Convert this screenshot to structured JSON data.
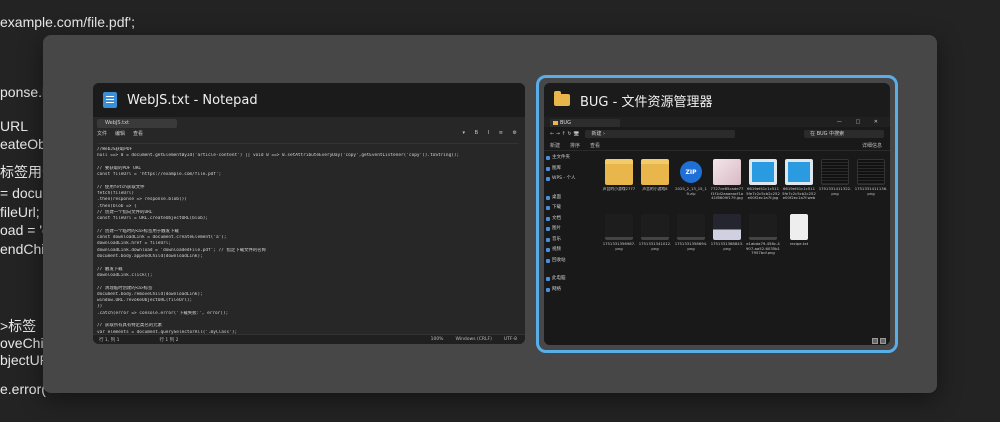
{
  "background_code": [
    "example.com/file.pdf';",
    "ponse.b",
    "URL",
    "eateObj",
    "标签用于",
    "= docum",
    "fileUrl;",
    "oad = 'c",
    "endChild",
    ">标签",
    "oveChilc",
    "bjectUR",
    "e.error("
  ],
  "switcher": {
    "notepad": {
      "title": "WebJS.txt - Notepad",
      "tab_label": "WebJS.txt",
      "menu": [
        "文件",
        "编辑",
        "查看"
      ],
      "tools": "▾ B I ≡ ⚙",
      "lines": [
        "//WebJS获取PDF",
        "null ==> 0 = document.getElementById('article-content') || void 0 ==> 0.setAttributeEveryDay('copy',getEventListener('copy')).toString();",
        "",
        "// 要获取的PDF URL",
        "const fileUrl = 'https://example.com/file.pdf';",
        "",
        "// 使用fetch获取文件",
        "fetch(fileUrl)",
        "  .then(response => response.blob())",
        "  .then(blob => {",
        "    // 创建一个指向文件的URL",
        "    const fileUrl = URL.createObjectURL(blob);",
        "",
        "    // 创建一个临时的<a>标签用于触发下载",
        "    const downloadLink = document.createElement('a');",
        "    downloadLink.href = fileUrl;",
        "    downloadLink.download = 'downloadedFile.pdf'; // 指定下载文件的名称",
        "    document.body.appendChild(downloadLink);",
        "",
        "    // 触发下载",
        "    downloadLink.click();",
        "",
        "    // 清理临时创建的<a>标签",
        "    document.body.removeChild(downloadLink);",
        "    window.URL.revokeObjectURL(fileUrl);",
        "  })",
        "  .catch(error => console.error('下载失败:', error));",
        "",
        "// 获取所有具有特定类名的元素",
        "var elements = document.querySelectorAll('.myClass');",
        "",
        "// 遍历所有元素",
        "elements.forEach(function(element) {",
        "  // 删除所有指定的事件监听器"
      ],
      "status": {
        "position": "行 1, 列 1",
        "chars": "行 1 列 2",
        "zoom": "100%",
        "encoding": "UTF-8",
        "line_ending": "Windows (CRLF)"
      }
    },
    "explorer": {
      "title": "BUG - 文件资源管理器",
      "tab_label": "BUG",
      "win_buttons": "— □ ✕",
      "addr_path": "新建 ›",
      "search_placeholder": "在 BUG 中搜索",
      "cmd_items": [
        "新建",
        "排序",
        "查看"
      ],
      "cmd_right": "详细信息",
      "nav_items": [
        {
          "label": "主文件夹"
        },
        {
          "label": "图库"
        },
        {
          "label": "WPS - 个人"
        },
        {
          "label": "桌面"
        },
        {
          "label": "下载"
        },
        {
          "label": "文档"
        },
        {
          "label": "图片"
        },
        {
          "label": "音乐"
        },
        {
          "label": "视频"
        },
        {
          "label": "回收站"
        },
        {
          "label": "此电脑"
        },
        {
          "label": "网络"
        }
      ],
      "files": [
        {
          "name": "声音的小游戏2777",
          "kind": "folder"
        },
        {
          "name": "声音的小游戏8",
          "kind": "folder"
        },
        {
          "name": "2025_2_13_15_19.zip",
          "kind": "zip"
        },
        {
          "name": "7727ce65cade77f1f1d2aaaeacf1a41f8609f179.jpg",
          "kind": "pic-pink"
        },
        {
          "name": "6619ef41c1c5115fe7c2c5cb2c252e00f2ec1a7f.jpg",
          "kind": "pic-blue"
        },
        {
          "name": "6619ef41c1c5115fe7c2c5cb2c252e00f2ec1a7f.webp",
          "kind": "pic-blue"
        },
        {
          "name": "1751331411322.png",
          "kind": "dark"
        },
        {
          "name": "1751331411136.png",
          "kind": "dark"
        },
        {
          "name": "1751331356987.png",
          "kind": "dark2"
        },
        {
          "name": "1751331341012.png",
          "kind": "dark2"
        },
        {
          "name": "1751331358694.png",
          "kind": "dark2"
        },
        {
          "name": "1751331368843.png",
          "kind": "mixed"
        },
        {
          "name": "e1abda79-456c-4907-aa52-6035b17957bcf.png",
          "kind": "dark2"
        },
        {
          "name": "recipe.txt",
          "kind": "doc"
        }
      ]
    }
  }
}
